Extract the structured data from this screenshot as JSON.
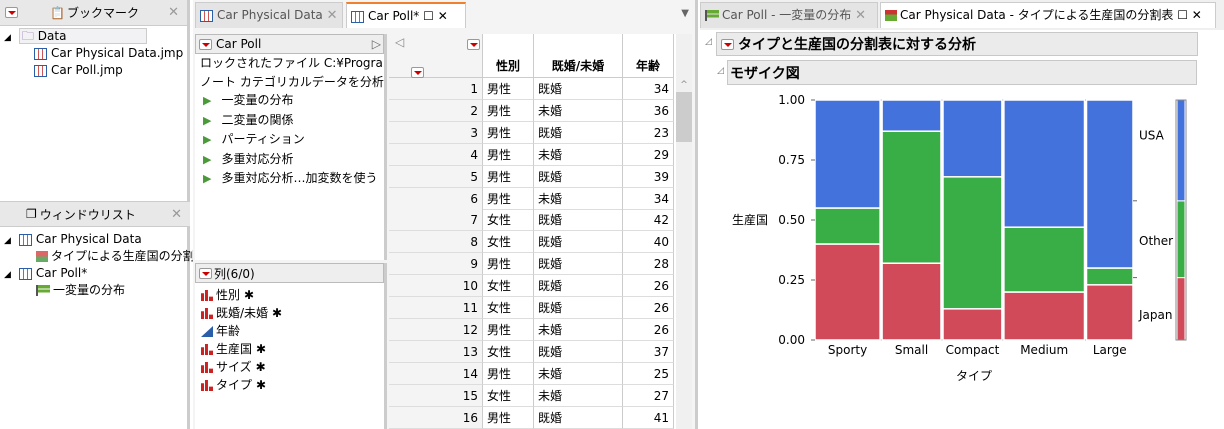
{
  "bookmarks": {
    "title": "ブックマーク",
    "folder": "Data",
    "files": [
      "Car Physical Data.jmp",
      "Car Poll.jmp"
    ]
  },
  "windowlist": {
    "title": "ウィンドウリスト",
    "items": [
      {
        "label": "Car Physical Data",
        "child": "タイプによる生産国の分割表"
      },
      {
        "label": "Car Poll*",
        "child": "一変量の分布"
      }
    ]
  },
  "tabs_mid": [
    "Car Physical Data",
    "Car Poll*"
  ],
  "tabs_right": [
    "Car Poll - 一変量の分布",
    "Car Physical Data - タイプによる生産国の分割表"
  ],
  "table_panel": {
    "title": "Car Poll",
    "locked": "ロックされたファイル  C:¥Progra",
    "note": "ノート  カテゴリカルデータを分析",
    "scripts": [
      "一変量の分布",
      "二変量の関係",
      "パーティション",
      "多重対応分析",
      "多重対応分析…加変数を使う"
    ]
  },
  "columns_panel": {
    "title": "列(6/0)",
    "columns": [
      {
        "name": "性別",
        "type": "nominal",
        "star": "✱"
      },
      {
        "name": "既婚/未婚",
        "type": "nominal",
        "star": "✱"
      },
      {
        "name": "年齢",
        "type": "continuous",
        "star": ""
      },
      {
        "name": "生産国",
        "type": "nominal",
        "star": "✱"
      },
      {
        "name": "サイズ",
        "type": "nominal",
        "star": "✱"
      },
      {
        "name": "タイプ",
        "type": "nominal",
        "star": "✱"
      }
    ]
  },
  "grid": {
    "headers": [
      "性別",
      "既婚/未婚",
      "年齢"
    ],
    "rows": [
      [
        "1",
        "男性",
        "既婚",
        "34"
      ],
      [
        "2",
        "男性",
        "未婚",
        "36"
      ],
      [
        "3",
        "男性",
        "既婚",
        "23"
      ],
      [
        "4",
        "男性",
        "未婚",
        "29"
      ],
      [
        "5",
        "男性",
        "既婚",
        "39"
      ],
      [
        "6",
        "男性",
        "未婚",
        "34"
      ],
      [
        "7",
        "女性",
        "既婚",
        "42"
      ],
      [
        "8",
        "女性",
        "既婚",
        "40"
      ],
      [
        "9",
        "男性",
        "既婚",
        "28"
      ],
      [
        "10",
        "女性",
        "既婚",
        "26"
      ],
      [
        "11",
        "女性",
        "既婚",
        "26"
      ],
      [
        "12",
        "男性",
        "未婚",
        "26"
      ],
      [
        "13",
        "女性",
        "既婚",
        "37"
      ],
      [
        "14",
        "男性",
        "未婚",
        "25"
      ],
      [
        "15",
        "女性",
        "未婚",
        "27"
      ],
      [
        "16",
        "男性",
        "既婚",
        "41"
      ]
    ]
  },
  "report": {
    "title": "タイプと生産国の分割表に対する分析",
    "section": "モザイク図"
  },
  "colors": {
    "Japan": "#d14a5a",
    "Other": "#3aae46",
    "USA": "#4472dc"
  },
  "chart_data": {
    "type": "mosaic",
    "xlabel": "タイプ",
    "ylabel": "生産国",
    "ylim": [
      0,
      1
    ],
    "yticks": [
      "0.00",
      "0.25",
      "0.50",
      "0.75",
      "1.00"
    ],
    "categories": [
      "Sporty",
      "Small",
      "Compact",
      "Medium",
      "Large"
    ],
    "widths": [
      0.21,
      0.19,
      0.19,
      0.26,
      0.15
    ],
    "series": [
      {
        "name": "Japan",
        "values": [
          0.4,
          0.32,
          0.13,
          0.2,
          0.23
        ]
      },
      {
        "name": "Other",
        "values": [
          0.15,
          0.55,
          0.55,
          0.27,
          0.07
        ]
      },
      {
        "name": "USA",
        "values": [
          0.45,
          0.13,
          0.32,
          0.53,
          0.7
        ]
      }
    ],
    "overall": [
      0.26,
      0.32,
      0.42
    ],
    "legend_labels": [
      "USA",
      "Other",
      "Japan"
    ]
  }
}
